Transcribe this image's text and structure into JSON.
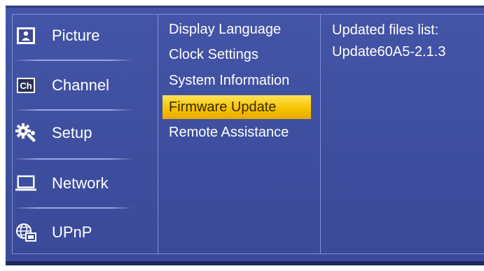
{
  "sidebar": {
    "items": [
      {
        "label": "Picture",
        "icon": "picture-icon"
      },
      {
        "label": "Channel",
        "icon": "channel-icon"
      },
      {
        "label": "Setup",
        "icon": "setup-gear-icon"
      },
      {
        "label": "Network",
        "icon": "network-laptop-icon"
      },
      {
        "label": "UPnP",
        "icon": "upnp-globe-icon"
      }
    ]
  },
  "submenu": {
    "items": [
      {
        "label": "Display Language"
      },
      {
        "label": "Clock Settings"
      },
      {
        "label": "System Information"
      },
      {
        "label": "Firmware Update",
        "selected": true
      },
      {
        "label": "Remote Assistance"
      }
    ]
  },
  "info": {
    "title": "Updated files list:",
    "files": [
      "Update60A5-2.1.3"
    ]
  },
  "colors": {
    "panel": "#4050a0",
    "border": "#7f8fd8",
    "highlight": "#f6c400",
    "text": "#ffffff"
  }
}
